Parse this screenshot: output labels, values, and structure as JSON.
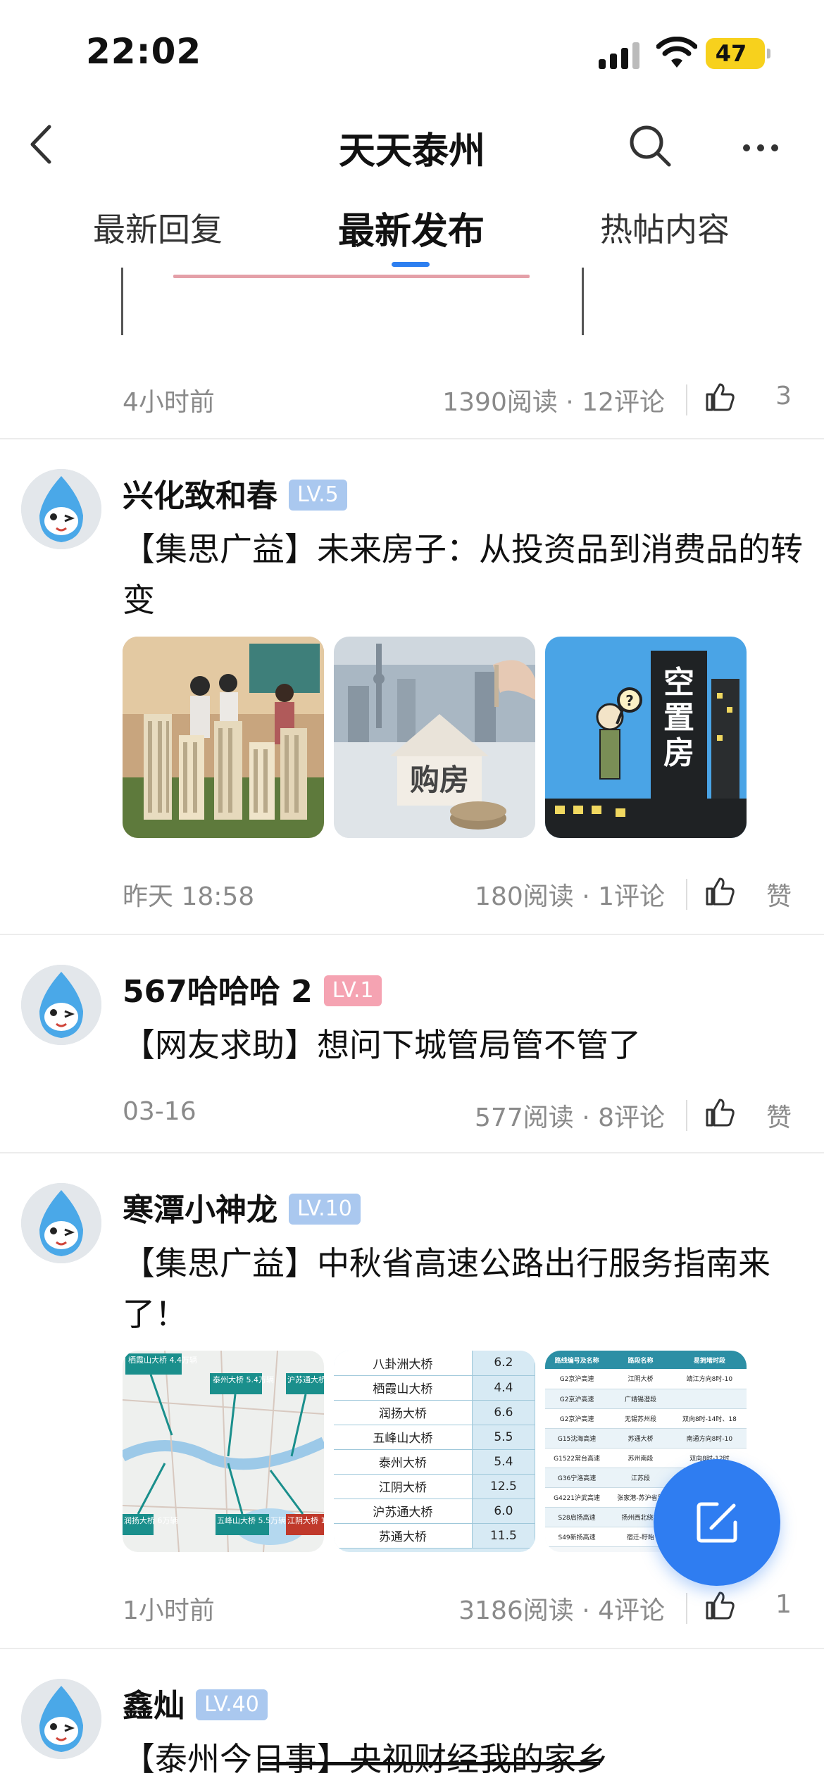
{
  "status_bar": {
    "time": "22:02",
    "battery": "47"
  },
  "nav": {
    "title": "天天泰州"
  },
  "tabs": [
    {
      "label": "最新回复",
      "active": false
    },
    {
      "label": "最新发布",
      "active": true
    },
    {
      "label": "热帖内容",
      "active": false
    }
  ],
  "top_card": {
    "time": "4小时前",
    "stats": "1390阅读 · 12评论",
    "likes": "3"
  },
  "posts": [
    {
      "author": "兴化致和春",
      "level": "LV.5",
      "title": "【集思广益】未来房子：从投资品到消费品的转变",
      "thumbs": [
        "楼盘沙盘",
        "购房",
        "空置房"
      ],
      "time": "昨天 18:58",
      "stats": "180阅读 · 1评论",
      "likes": "赞"
    },
    {
      "author": "567哈哈哈 2",
      "level": "LV.1",
      "title": "【网友求助】想问下城管局管不管了",
      "time": "03-16",
      "stats": "577阅读 · 8评论",
      "likes": "赞"
    },
    {
      "author": "寒潭小神龙",
      "level": "LV.10",
      "title": "【集思广益】中秋省高速公路出行服务指南来了！",
      "time": "1小时前",
      "stats": "3186阅读 · 4评论",
      "likes": "1",
      "map_labels": [
        "栖霞山大桥 4.4万辆",
        "泰州大桥 5.4万辆",
        "沪苏通大桥 6.0万辆",
        "五峰山大桥 5.5万辆",
        "江阴大桥 12.5万辆",
        "润扬大桥 6万辆"
      ],
      "bridge_table": [
        [
          "八卦洲大桥",
          "6.2"
        ],
        [
          "栖霞山大桥",
          "4.4"
        ],
        [
          "润扬大桥",
          "6.6"
        ],
        [
          "五峰山大桥",
          "5.5"
        ],
        [
          "泰州大桥",
          "5.4"
        ],
        [
          "江阴大桥",
          "12.5"
        ],
        [
          "沪苏通大桥",
          "6.0"
        ],
        [
          "苏通大桥",
          "11.5"
        ]
      ],
      "road_table_header": [
        "路线编号及名称",
        "路段名称",
        "易拥堵时段"
      ],
      "road_table": [
        [
          "G2京沪高速",
          "江阴大桥",
          "靖江方向8时-10"
        ],
        [
          "G2京沪高速",
          "广靖锡澄段",
          ""
        ],
        [
          "G2京沪高速",
          "无锡苏州段",
          "双向8时-14时、18"
        ],
        [
          "G15沈海高速",
          "苏通大桥",
          "南通方向8时-10"
        ],
        [
          "G1522常台高速",
          "苏州南段",
          "双向8时-12时"
        ],
        [
          "G36宁洛高速",
          "江苏段",
          ""
        ],
        [
          "G4221沪武高速",
          "张家港-苏沪省界",
          ""
        ],
        [
          "S28启扬高速",
          "扬州西北绕城",
          ""
        ],
        [
          "S49新扬高速",
          "宿迁-盱眙",
          ""
        ]
      ]
    },
    {
      "author": "鑫灿",
      "level": "LV.40",
      "title": "【泰州今日事】央视财经我的家乡"
    }
  ],
  "colors": {
    "accent": "#2d7ff0",
    "badge_blue": "#aac8ef",
    "badge_pink": "#f5a3b2",
    "meta": "#8a8a8a"
  }
}
